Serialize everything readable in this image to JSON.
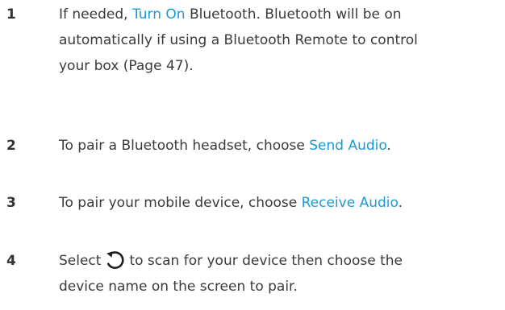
{
  "steps": [
    {
      "number": "1",
      "lines": [
        {
          "pre": "If needed, ",
          "link": "Turn On",
          "post": " Bluetooth. Bluetooth will be on"
        },
        {
          "text": "automatically if using a Bluetooth Remote to control"
        },
        {
          "text": "your box (Page 47)."
        }
      ]
    },
    {
      "number": "2",
      "pre": "To pair a Bluetooth headset, choose ",
      "link": "Send Audio",
      "post": "."
    },
    {
      "number": "3",
      "pre": "To pair your mobile device, choose ",
      "link": "Receive Audio",
      "post": "."
    },
    {
      "number": "4",
      "lines": [
        {
          "pre": "Select",
          "icon": "refresh-icon",
          "post": "to scan for your device then choose the"
        },
        {
          "text": "device name on the screen to pair."
        }
      ]
    }
  ],
  "colors": {
    "text": "#3a3a3a",
    "link": "#1a9ad6"
  }
}
